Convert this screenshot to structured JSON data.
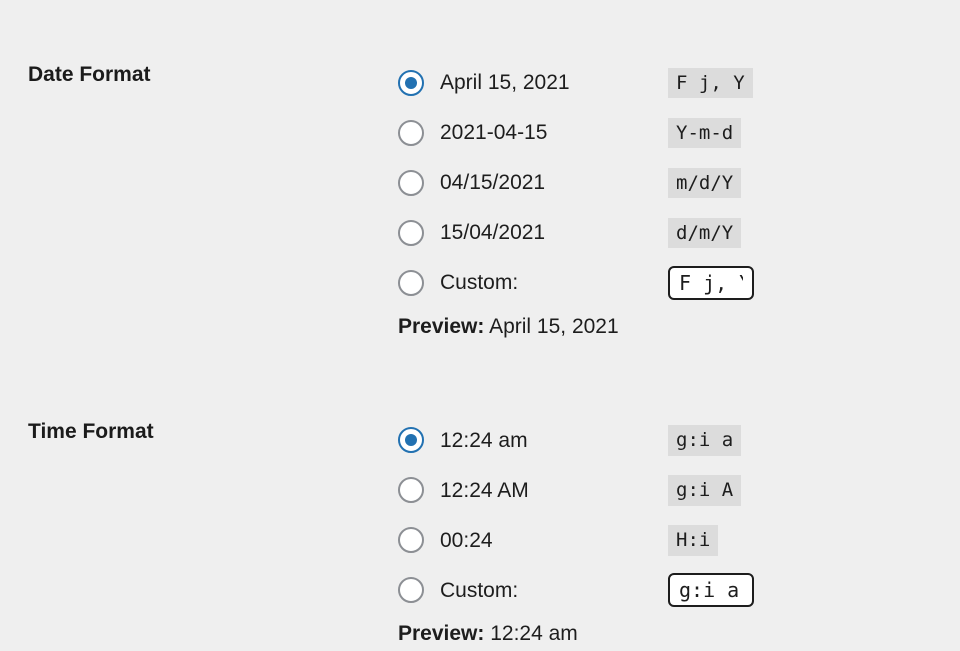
{
  "date": {
    "section_label": "Date Format",
    "options": [
      {
        "display": "April 15, 2021",
        "code": "F j, Y",
        "checked": true
      },
      {
        "display": "2021-04-15",
        "code": "Y-m-d",
        "checked": false
      },
      {
        "display": "04/15/2021",
        "code": "m/d/Y",
        "checked": false
      },
      {
        "display": "15/04/2021",
        "code": "d/m/Y",
        "checked": false
      }
    ],
    "custom_label": "Custom:",
    "custom_value": "F j, Y",
    "preview_label": "Preview:",
    "preview_value": "April 15, 2021"
  },
  "time": {
    "section_label": "Time Format",
    "options": [
      {
        "display": "12:24 am",
        "code": "g:i a",
        "checked": true
      },
      {
        "display": "12:24 AM",
        "code": "g:i A",
        "checked": false
      },
      {
        "display": "00:24",
        "code": "H:i",
        "checked": false
      }
    ],
    "custom_label": "Custom:",
    "custom_value": "g:i a",
    "preview_label": "Preview:",
    "preview_value": "12:24 am"
  }
}
